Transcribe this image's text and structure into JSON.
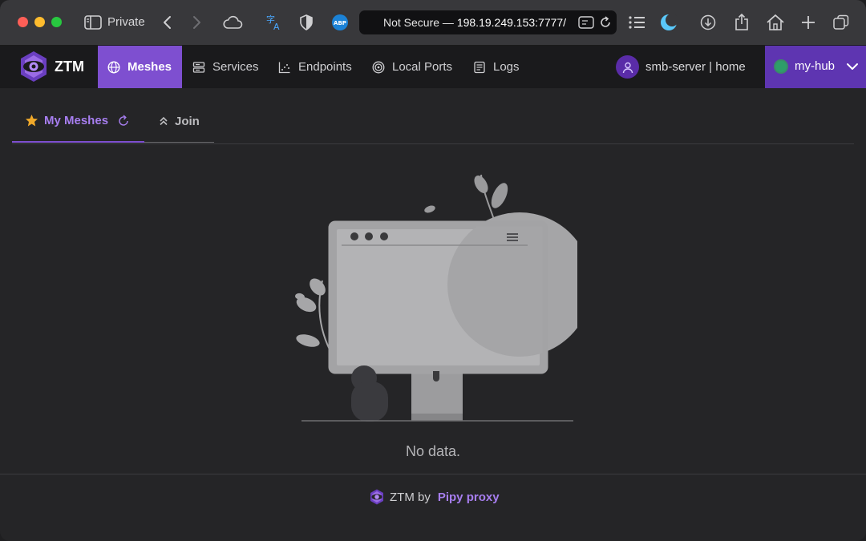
{
  "browser": {
    "private_label": "Private",
    "address_prefix": "Not Secure — ",
    "address_host": "198.19.249.153:7777/",
    "icons": [
      "sidebar-icon",
      "back-icon",
      "forward-icon",
      "cloud-icon",
      "translate-icon",
      "shield-icon",
      "abp-icon",
      "reader-icon",
      "reload-icon",
      "list-icon",
      "moon-icon",
      "download-icon",
      "share-icon",
      "home-icon",
      "new-tab-icon",
      "tabs-icon"
    ],
    "abp_badge": "ABP"
  },
  "app": {
    "logo_text": "ZTM",
    "nav": [
      {
        "label": "Meshes",
        "icon": "globe-icon",
        "active": true
      },
      {
        "label": "Services",
        "icon": "server-icon",
        "active": false
      },
      {
        "label": "Endpoints",
        "icon": "scatter-icon",
        "active": false
      },
      {
        "label": "Local Ports",
        "icon": "target-icon",
        "active": false
      },
      {
        "label": "Logs",
        "icon": "document-icon",
        "active": false
      }
    ],
    "user_label": "smb-server | home",
    "hub_label": "my-hub",
    "accent_color": "#7e4fd0"
  },
  "tabs": {
    "my_meshes": "My Meshes",
    "join": "Join"
  },
  "empty_state": {
    "message": "No data."
  },
  "footer": {
    "prefix": "ZTM by",
    "link": "Pipy proxy"
  }
}
